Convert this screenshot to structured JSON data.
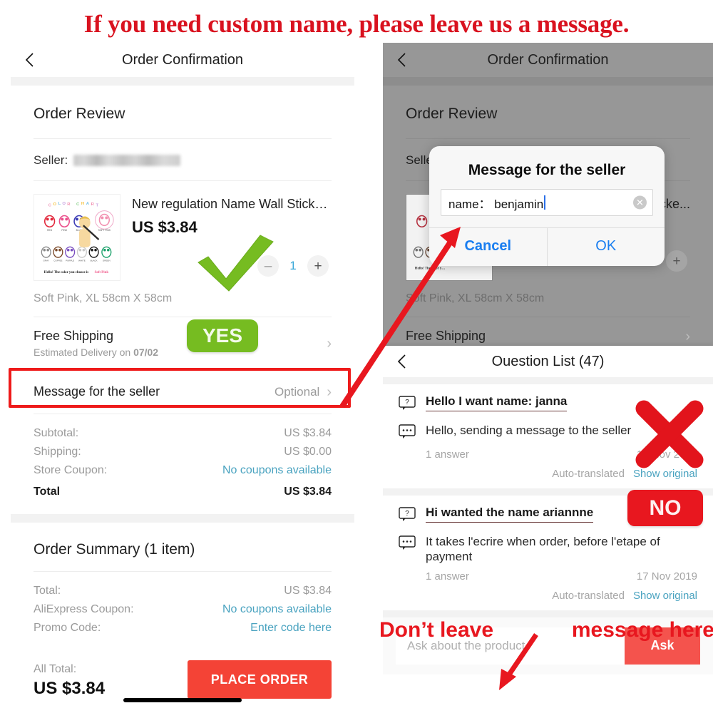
{
  "banner": {
    "text": "If you need custom name, please leave us a message."
  },
  "left_phone": {
    "navbar": {
      "title": "Order Confirmation",
      "back_icon": "chevron-left-icon"
    },
    "order_review": {
      "heading": "Order Review"
    },
    "seller": {
      "label": "Seller:",
      "value_masked": ""
    },
    "product": {
      "name": "New regulation Name Wall Sticke...",
      "price": "US $3.84",
      "variant": "Soft Pink, XL 58cm X 58cm",
      "quantity": "1",
      "minus_label": "–",
      "plus_label": "+",
      "thumb_caption": "Hello! The color you choose is Soft Pink",
      "thumb_header": "COLOR CHART",
      "thumb_colors_row1": [
        "RED",
        "PINK",
        "BLUE",
        "SOFT PINK"
      ],
      "thumb_colors_row2": [
        "GRAY",
        "COFFEE",
        "PURPLE",
        "WHITE",
        "BLACK",
        "GREEN"
      ]
    },
    "shipping": {
      "title": "Free Shipping",
      "subtitle_prefix": "Estimated Delivery on ",
      "date": "07/02"
    },
    "message_row": {
      "label": "Message for the seller",
      "value": "Optional"
    },
    "totals": [
      {
        "label": "Subtotal:",
        "value": "US $3.84",
        "style": "muted"
      },
      {
        "label": "Shipping:",
        "value": "US $0.00",
        "style": "muted"
      },
      {
        "label": "Store Coupon:",
        "value": "No coupons available",
        "style": "link"
      },
      {
        "label": "Total",
        "value": "US $3.84",
        "style": "bold"
      }
    ],
    "order_summary": {
      "heading": "Order Summary (1 item)",
      "rows": [
        {
          "label": "Total:",
          "value": "US $3.84",
          "style": "muted"
        },
        {
          "label": "AliExpress Coupon:",
          "value": "No coupons available",
          "style": "link"
        },
        {
          "label": "Promo Code:",
          "value": "Enter code here",
          "style": "link"
        }
      ],
      "all_total_label": "All Total:",
      "all_total_value": "US $3.84",
      "place_order_label": "PLACE ORDER"
    }
  },
  "right_phone": {
    "navbar": {
      "title": "Order Confirmation",
      "back_icon": "chevron-left-icon"
    },
    "order_review": {
      "heading": "Order Review"
    },
    "seller": {
      "label": "Seller"
    },
    "product": {
      "name_tail": "cke...",
      "variant": "Soft Pink, XL 58cm X 58cm",
      "plus_label": "+"
    },
    "shipping": {
      "title": "Free Shipping"
    },
    "dialog": {
      "title": "Message for the seller",
      "input_value": "name： benjamin",
      "input_placeholder": "",
      "clear_icon": "clear-circle-icon",
      "cancel_label": "Cancel",
      "ok_label": "OK"
    },
    "question_list": {
      "navbar": {
        "title": "Ouestion List (47)",
        "back_icon": "chevron-left-icon"
      },
      "items": [
        {
          "question": "Hello I want name: janna",
          "answer": "Hello, sending a message to the seller",
          "answer_count": "1 answer",
          "date": "17 Nov 2019",
          "auto_translated": "Auto-translated",
          "show_original": "Show original"
        },
        {
          "question": "Hi wanted the name ariannne",
          "answer": "It takes l'ecrire when order, before l'etape of payment",
          "answer_count": "1 answer",
          "date": "17 Nov 2019",
          "auto_translated": "Auto-translated",
          "show_original": "Show original"
        }
      ],
      "ask_placeholder": "Ask about the product.",
      "ask_button_label": "Ask"
    }
  },
  "annotations": {
    "yes_badge": "YES",
    "no_badge": "NO",
    "bottom_note_left": "Don’t leave",
    "bottom_note_right": "message here",
    "check_icon": "green-checkmark-icon",
    "cross_icon": "red-cross-icon",
    "arrow_to_dialog": "red-arrow-icon",
    "arrow_to_ask": "red-arrow-icon",
    "highlight_box": "red-highlight-box"
  },
  "colors": {
    "brand_red": "#f44336",
    "banner_red": "#d9121f",
    "annotation_red": "#e8171f",
    "yes_green": "#76bc21",
    "link_blue": "#4aa3c0",
    "dialog_blue": "#1a7ef0",
    "dim_gray": "#979797"
  }
}
